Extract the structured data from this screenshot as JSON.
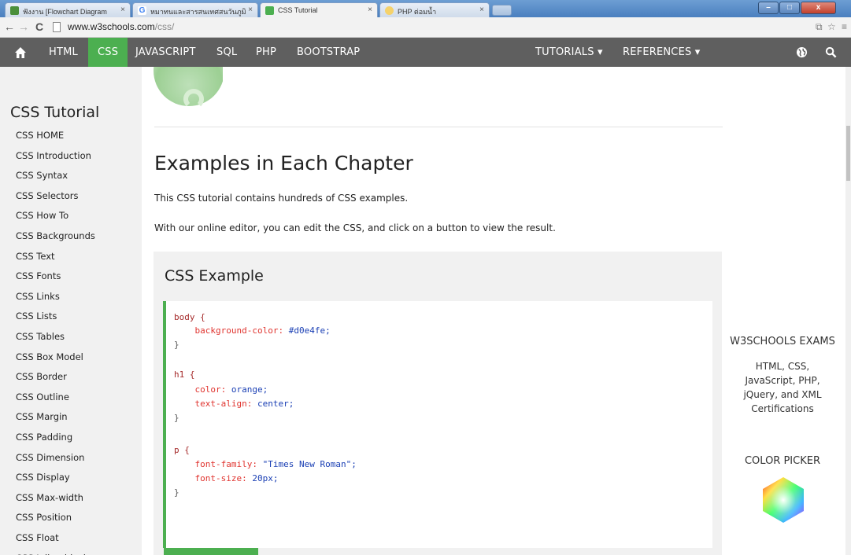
{
  "browser": {
    "tabs": [
      {
        "label": "ฟังงาน [Flowchart Diagram",
        "favicon_color": "#4a8f3a"
      },
      {
        "label": "หมาทนและสารสนเทศสนวันภูมิ",
        "favicon_color": "#4285f4"
      },
      {
        "label": "CSS Tutorial",
        "favicon_color": "#4caf50"
      },
      {
        "label": "PHP ต่อมน้ำ",
        "favicon_color": "#f5a623"
      }
    ],
    "tab_close_glyph": "×",
    "url_host": "www.w3schools.com",
    "url_path": "/css/",
    "window_controls": [
      "–",
      "□",
      "x"
    ]
  },
  "topnav": {
    "items": [
      "HTML",
      "CSS",
      "JAVASCRIPT",
      "SQL",
      "PHP",
      "BOOTSTRAP"
    ],
    "active": "CSS",
    "tutorials": "TUTORIALS ▾",
    "references": "REFERENCES ▾",
    "home_icon": "home-icon",
    "globe_icon": "globe-icon",
    "search_icon": "search-icon",
    "bg_color": "#5f5f5f",
    "accent_color": "#4caf50"
  },
  "sidebar": {
    "title": "CSS Tutorial",
    "links": [
      "CSS HOME",
      "CSS Introduction",
      "CSS Syntax",
      "CSS Selectors",
      "CSS How To",
      "CSS Backgrounds",
      "CSS Text",
      "CSS Fonts",
      "CSS Links",
      "CSS Lists",
      "CSS Tables",
      "CSS Box Model",
      "CSS Border",
      "CSS Outline",
      "CSS Margin",
      "CSS Padding",
      "CSS Dimension",
      "CSS Display",
      "CSS Max-width",
      "CSS Position",
      "CSS Float",
      "CSS Inline-block"
    ]
  },
  "main": {
    "heading": "Examples in Each Chapter",
    "para1": "This CSS tutorial contains hundreds of CSS examples.",
    "para2": "With our online editor, you can edit the CSS, and click on a button to view the result.",
    "example_title": "CSS Example",
    "code": {
      "body_sel": "body {",
      "body_prop": "background-color:",
      "body_val": "#d0e4fe;",
      "h1_sel": "h1 {",
      "h1_prop1": "color:",
      "h1_val1": "orange;",
      "h1_prop2": "text-align:",
      "h1_val2": "center;",
      "p_sel": "p {",
      "p_prop1": "font-family:",
      "p_val1": "\"Times New Roman\";",
      "p_prop2": "font-size:",
      "p_val2": "20px;",
      "close": "}"
    }
  },
  "right": {
    "exams_title": "W3SCHOOLS EXAMS",
    "exams_desc": [
      "HTML, CSS,",
      "JavaScript, PHP,",
      "jQuery, and XML",
      "Certifications"
    ],
    "picker_title": "COLOR PICKER"
  }
}
